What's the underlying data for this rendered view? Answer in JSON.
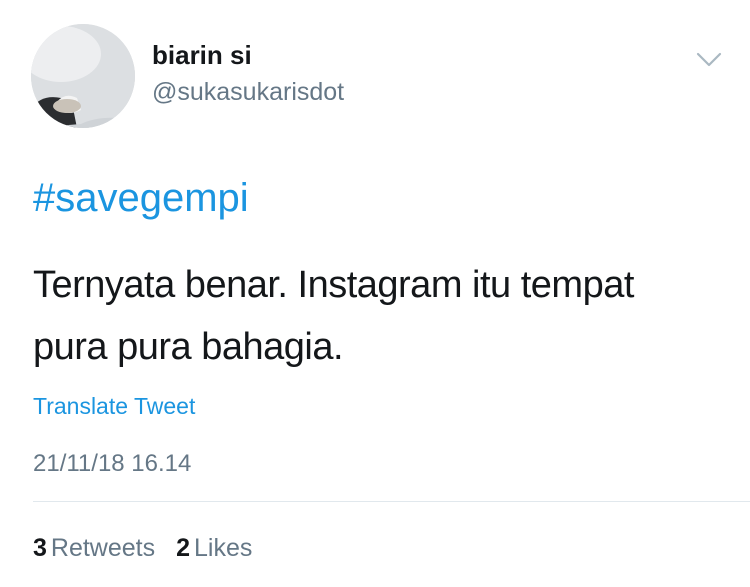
{
  "user": {
    "display_name": "biarin si",
    "handle": "@sukasukarisdot"
  },
  "tweet": {
    "hashtag": "#savegempi",
    "text_lines": [
      "Ternyata benar. Instagram itu tempat",
      "pura pura bahagia."
    ],
    "translate_label": "Translate Tweet",
    "timestamp": "21/11/18 16.14"
  },
  "stats": {
    "retweets_count": "3",
    "retweets_label": "Retweets",
    "likes_count": "2",
    "likes_label": "Likes"
  },
  "icons": {
    "caret": "chevron-down-icon"
  },
  "colors": {
    "link": "#1b95e0",
    "secondary_text": "#657786",
    "primary_text": "#14171a",
    "divider": "#e1e8ed"
  }
}
